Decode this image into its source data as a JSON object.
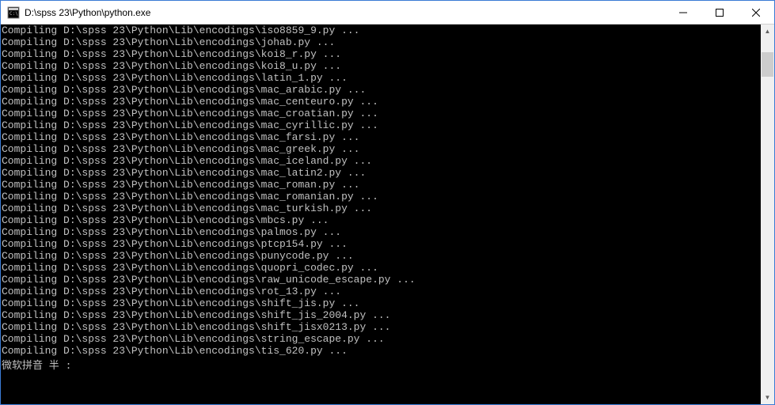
{
  "window": {
    "title": "D:\\spss 23\\Python\\python.exe"
  },
  "controls": {
    "minimize": "─",
    "maximize": "☐",
    "close": "✕"
  },
  "console": {
    "prefix": "Compiling ",
    "base_path": "D:\\spss 23\\Python\\Lib\\encodings\\",
    "suffix": " ...",
    "files": [
      "iso8859_9.py",
      "johab.py",
      "koi8_r.py",
      "koi8_u.py",
      "latin_1.py",
      "mac_arabic.py",
      "mac_centeuro.py",
      "mac_croatian.py",
      "mac_cyrillic.py",
      "mac_farsi.py",
      "mac_greek.py",
      "mac_iceland.py",
      "mac_latin2.py",
      "mac_roman.py",
      "mac_romanian.py",
      "mac_turkish.py",
      "mbcs.py",
      "palmos.py",
      "ptcp154.py",
      "punycode.py",
      "quopri_codec.py",
      "raw_unicode_escape.py",
      "rot_13.py",
      "shift_jis.py",
      "shift_jis_2004.py",
      "shift_jisx0213.py",
      "string_escape.py",
      "tis_620.py"
    ],
    "ime_status": "微软拼音 半 :"
  },
  "scrollbar": {
    "up": "▲",
    "down": "▼",
    "thumb_top_pct": 4,
    "thumb_height_pct": 7
  }
}
